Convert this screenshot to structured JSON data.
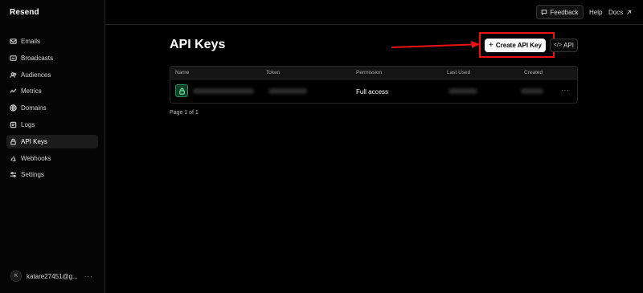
{
  "brand": "Resend",
  "sidebar": {
    "items": [
      {
        "label": "Emails",
        "icon": "mail-icon",
        "active": false
      },
      {
        "label": "Broadcasts",
        "icon": "broadcast-icon",
        "active": false
      },
      {
        "label": "Audiences",
        "icon": "users-icon",
        "active": false
      },
      {
        "label": "Metrics",
        "icon": "chart-icon",
        "active": false
      },
      {
        "label": "Domains",
        "icon": "globe-icon",
        "active": false
      },
      {
        "label": "Logs",
        "icon": "logs-icon",
        "active": false
      },
      {
        "label": "API Keys",
        "icon": "lock-icon",
        "active": true
      },
      {
        "label": "Webhooks",
        "icon": "webhook-icon",
        "active": false
      },
      {
        "label": "Settings",
        "icon": "sliders-icon",
        "active": false
      }
    ],
    "account": {
      "initial": "K",
      "email": "katare27451@g...",
      "menu": "···"
    }
  },
  "topbar": {
    "feedback": "Feedback",
    "help": "Help",
    "docs": "Docs"
  },
  "main": {
    "title": "API Keys",
    "create_button": "Create API Key",
    "api_button": "API",
    "table": {
      "headers": [
        "Name",
        "Token",
        "Permission",
        "Last Used",
        "Created"
      ],
      "rows": [
        {
          "permission": "Full access",
          "menu": "···"
        }
      ]
    },
    "pagination": "Page 1 of 1"
  },
  "colors": {
    "accent": "#ffffff",
    "highlight": "#e11111",
    "key_icon": "#2a8a58"
  }
}
